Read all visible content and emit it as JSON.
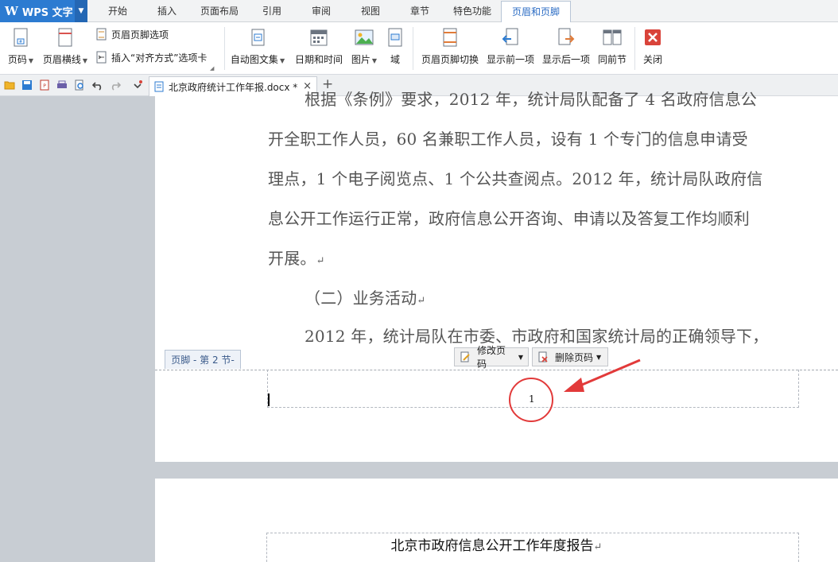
{
  "app": {
    "logo": "W",
    "name": "WPS 文字"
  },
  "menu": {
    "tabs": [
      "开始",
      "插入",
      "页面布局",
      "引用",
      "审阅",
      "视图",
      "章节",
      "特色功能",
      "页眉和页脚"
    ],
    "active_tab": "页眉和页脚"
  },
  "ribbon": {
    "page_number": "页码",
    "header_line": "页眉横线",
    "hf_options": "页眉页脚选项",
    "insert_align_tab": "插入“对齐方式”选项卡",
    "autotext": "自动图文集",
    "date_time": "日期和时间",
    "picture": "图片",
    "field": "域",
    "switch_hf": "页眉页脚切换",
    "show_prev": "显示前一项",
    "show_next": "显示后一项",
    "same_as_prev": "同前节",
    "close": "关闭"
  },
  "document_tab": {
    "filename": "北京政府统计工作年报.docx *",
    "close": "×",
    "new_tab": "+"
  },
  "page1": {
    "lines": [
      "根据《条例》要求，2012 年，统计局队配备了 4 名政府信息公",
      "开全职工作人员，60 名兼职工作人员，设有 1 个专门的信息申请受",
      "理点，1 个电子阅览点、1 个公共查阅点。2012 年，统计局队政府信",
      "息公开工作运行正常，政府信息公开咨询、申请以及答复工作均顺利",
      "开展。",
      "（二）业务活动",
      "2012 年，统计局队在市委、市政府和国家统计局的正确领导下，"
    ],
    "pilcrow": "↵"
  },
  "footer": {
    "tag": "页脚  - 第 2 节-",
    "modify_btn": "修改页码",
    "delete_btn": "删除页码",
    "page_number": "1"
  },
  "page2": {
    "header_text": "北京市政府信息公开工作年度报告"
  },
  "colors": {
    "accent": "#2c7bd1",
    "highlight": "#e23a3a",
    "text": "#555555"
  }
}
